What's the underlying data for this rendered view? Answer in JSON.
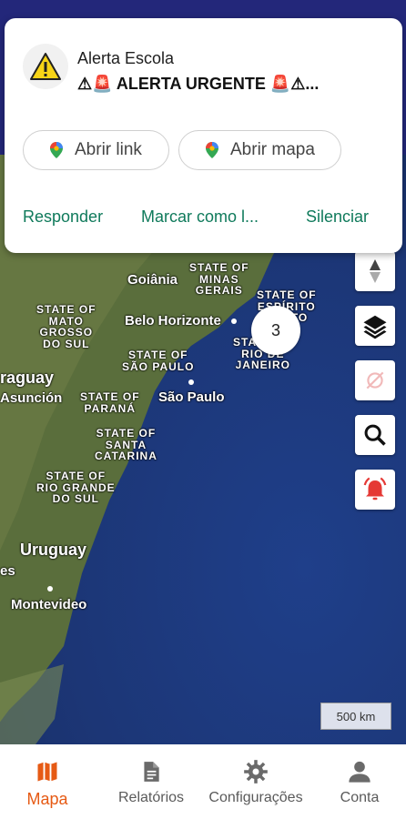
{
  "notification": {
    "app_name": "Alerta Escola",
    "text": "⚠🚨 ALERTA URGENTE 🚨⚠...",
    "chips": [
      {
        "label": "Abrir link",
        "icon": "maps-pin-icon"
      },
      {
        "label": "Abrir mapa",
        "icon": "maps-pin-icon"
      }
    ],
    "actions": [
      "Responder",
      "Marcar como l...",
      "Silenciar"
    ]
  },
  "map": {
    "labels": {
      "goiania": "Goiânia",
      "minas": "STATE OF\nMINAS\nGERAIS",
      "espirito": "STATE OF\nESPÍRITO\nSANTO",
      "mato_grosso": "STATE OF\nMATO\nGROSSO\nDO SUL",
      "belo_horizonte": "Belo Horizonte",
      "sao_paulo_state": "STATE OF\nSÃO PAULO",
      "rio_state": "STATE OF\nRIO DE\nJANEIRO",
      "paraguay": "raguay",
      "asuncion": "Asunción",
      "parana": "STATE OF\nPARANÁ",
      "sao_paulo": "São Paulo",
      "santa_catarina": "STATE OF\nSANTA\nCATARINA",
      "rio_grande": "STATE OF\nRIO GRANDE\nDO SUL",
      "uruguay": "Uruguay",
      "es": "es",
      "montevideo": "Montevideo"
    },
    "cluster_count": "3",
    "scale": "500 km"
  },
  "controls": [
    "compass-icon",
    "layers-icon",
    "location-off-icon",
    "search-icon",
    "alarm-bell-icon"
  ],
  "nav": {
    "items": [
      {
        "label": "Mapa",
        "icon": "map-icon",
        "active": true
      },
      {
        "label": "Relatórios",
        "icon": "document-icon",
        "active": false
      },
      {
        "label": "Configurações",
        "icon": "gear-icon",
        "active": false
      },
      {
        "label": "Conta",
        "icon": "person-icon",
        "active": false
      }
    ]
  },
  "colors": {
    "accent": "#e65a14",
    "action_green": "#0f7a5b",
    "alarm_red": "#e53935",
    "appbar": "#23277a"
  }
}
